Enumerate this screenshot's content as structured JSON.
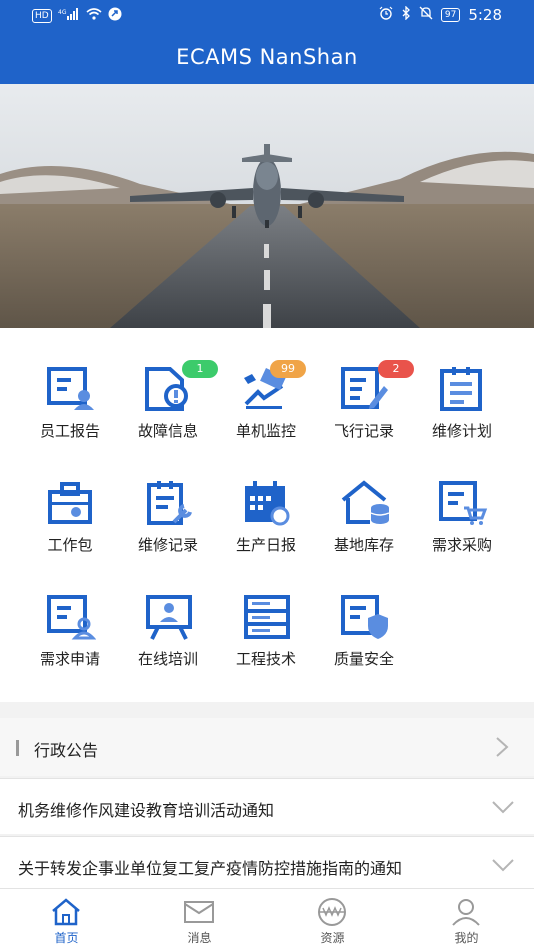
{
  "status_bar": {
    "left_text": "HD 4G",
    "battery": "97",
    "time": "5:28"
  },
  "app": {
    "title": "ECAMS NanShan"
  },
  "colors": {
    "brand_blue": "#1f63c9",
    "badge_green": "#3ccb6b",
    "badge_orange": "#f0a447",
    "badge_red": "#e9534b"
  },
  "grid": {
    "items": [
      {
        "label": "员工报告",
        "icon": "employee-report-icon"
      },
      {
        "label": "故障信息",
        "icon": "fault-info-icon",
        "badge": "1",
        "badge_color": "green"
      },
      {
        "label": "单机监控",
        "icon": "aircraft-monitor-icon",
        "badge": "99",
        "badge_color": "orange"
      },
      {
        "label": "飞行记录",
        "icon": "flight-record-icon",
        "badge": "2",
        "badge_color": "red"
      },
      {
        "label": "维修计划",
        "icon": "maintenance-plan-icon"
      },
      {
        "label": "工作包",
        "icon": "work-package-icon"
      },
      {
        "label": "维修记录",
        "icon": "maintenance-record-icon"
      },
      {
        "label": "生产日报",
        "icon": "daily-report-icon"
      },
      {
        "label": "基地库存",
        "icon": "base-inventory-icon"
      },
      {
        "label": "需求采购",
        "icon": "purchase-request-icon"
      },
      {
        "label": "需求申请",
        "icon": "demand-application-icon"
      },
      {
        "label": "在线培训",
        "icon": "online-training-icon"
      },
      {
        "label": "工程技术",
        "icon": "engineering-tech-icon"
      },
      {
        "label": "质量安全",
        "icon": "quality-safety-icon"
      }
    ]
  },
  "notices": {
    "header": "行政公告",
    "items": [
      "机务维修作风建设教育培训活动通知",
      "关于转发企事业单位复工复产疫情防控措施指南的通知"
    ]
  },
  "tabbar": {
    "tabs": [
      {
        "label": "首页",
        "icon": "home-icon",
        "active": true
      },
      {
        "label": "消息",
        "icon": "message-icon"
      },
      {
        "label": "资源",
        "icon": "resource-icon"
      },
      {
        "label": "我的",
        "icon": "profile-icon"
      }
    ]
  }
}
